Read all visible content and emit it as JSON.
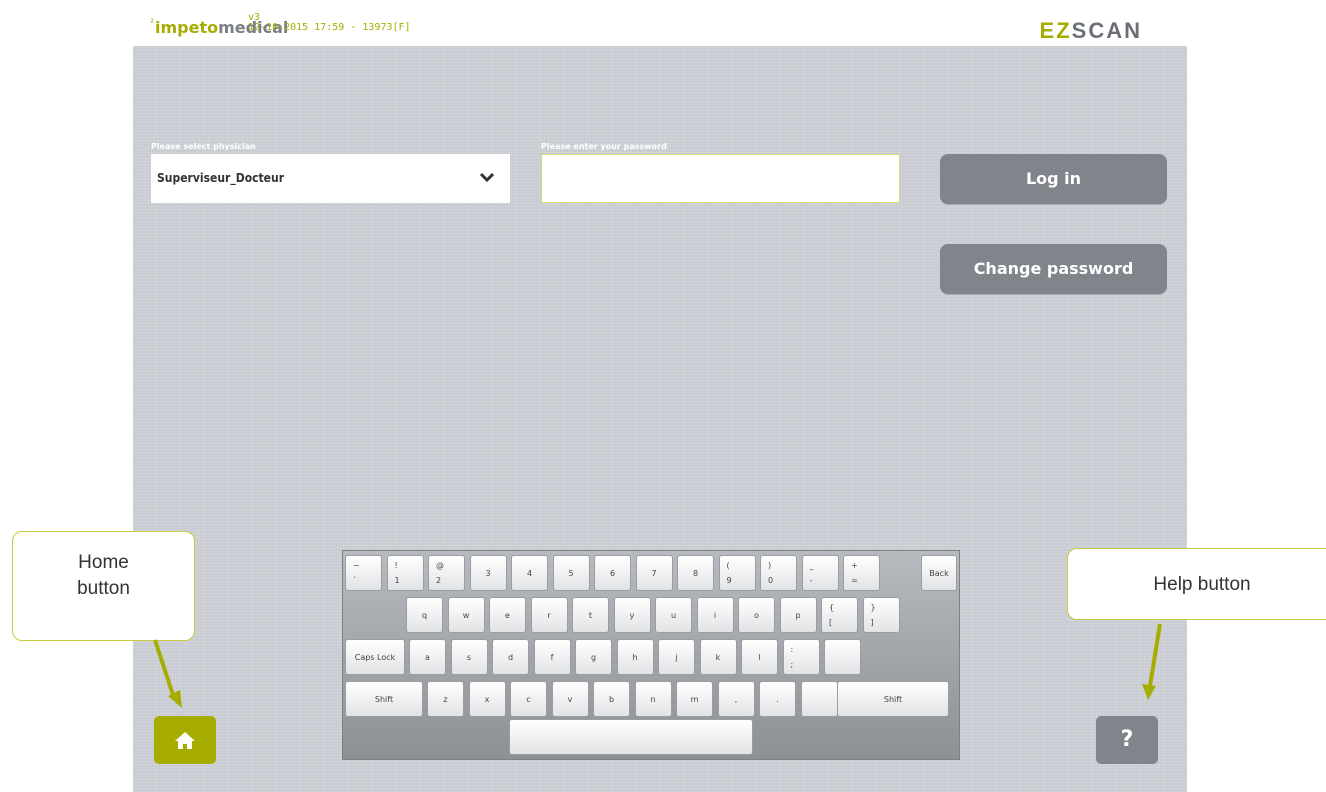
{
  "header": {
    "brand_prefix": "²",
    "brand_part1": "impeto",
    "brand_part2": "medical",
    "version": "v3",
    "datetime": "12-10-2015 17:59 - 13973[F]",
    "product_part1": "EZ",
    "product_part2": "SCAN"
  },
  "login": {
    "physician_label": "Please select physician",
    "physician_value": "Superviseur_Docteur",
    "password_label": "Please enter your password",
    "password_value": "",
    "login_button": "Log in",
    "change_password_button": "Change password"
  },
  "keyboard": {
    "row1": [
      {
        "top": "~",
        "bottom": "`"
      },
      {
        "top": "!",
        "bottom": "1"
      },
      {
        "top": "@",
        "bottom": "2"
      },
      {
        "top": "",
        "bottom": "",
        "center": "3"
      },
      {
        "top": "",
        "bottom": "",
        "center": "4"
      },
      {
        "top": "",
        "bottom": "",
        "center": "5"
      },
      {
        "top": "",
        "bottom": "",
        "center": "6"
      },
      {
        "top": "",
        "bottom": "",
        "center": "7"
      },
      {
        "top": "",
        "bottom": "",
        "center": "8"
      },
      {
        "top": "(",
        "bottom": "9"
      },
      {
        "top": ")",
        "bottom": "0"
      },
      {
        "top": "_",
        "bottom": "-"
      },
      {
        "top": "+",
        "bottom": "="
      }
    ],
    "back": "Back",
    "row2": [
      "q",
      "w",
      "e",
      "r",
      "t",
      "y",
      "u",
      "i",
      "o",
      "p"
    ],
    "row2_extra": [
      {
        "top": "{",
        "bottom": "["
      },
      {
        "top": "}",
        "bottom": "]"
      }
    ],
    "caps": "Caps Lock",
    "row3": [
      "a",
      "s",
      "d",
      "f",
      "g",
      "h",
      "j",
      "k",
      "l"
    ],
    "row3_extra": [
      {
        "top": ":",
        "bottom": ";"
      }
    ],
    "shift": "Shift",
    "row4": [
      "z",
      "x",
      "c",
      "v",
      "b",
      "n",
      "m",
      ",",
      "."
    ]
  },
  "callouts": {
    "home_line1": "Home",
    "home_line2": "button",
    "help": "Help button"
  },
  "icons": {
    "home": "home-icon",
    "help": "question-mark-icon",
    "dropdown": "chevron-down-icon"
  },
  "help_label": "?",
  "colors": {
    "accent": "#a6ad00",
    "button_grey": "#80848b",
    "panel": "#c8ccd2"
  }
}
